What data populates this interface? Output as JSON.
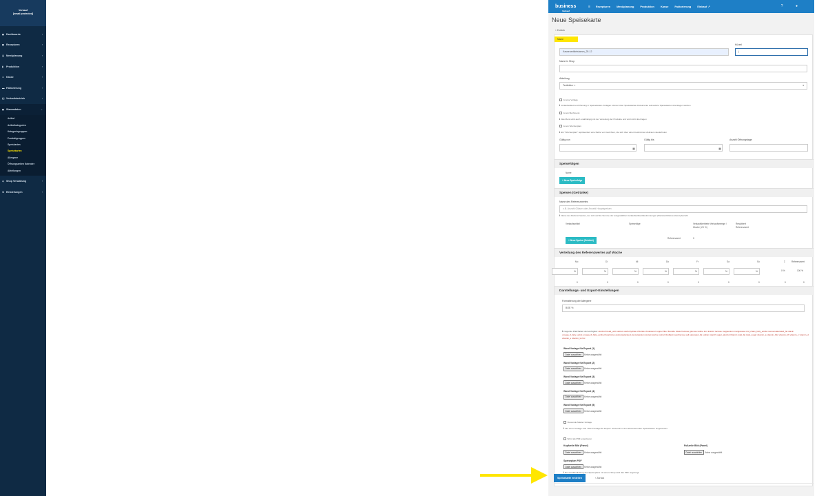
{
  "sidebar": {
    "user": [
      "Verkauf",
      "[email protected]"
    ],
    "items": [
      {
        "label": "Dashboards",
        "icon": "dashboard-icon",
        "glyph": "◼"
      },
      {
        "label": "Rezepturen",
        "icon": "recipe-icon",
        "glyph": "◼"
      },
      {
        "label": "Menüplanung",
        "icon": "menu-planning-icon",
        "glyph": "▤"
      },
      {
        "label": "Produktion",
        "icon": "production-icon",
        "glyph": "▮"
      },
      {
        "label": "Kasse",
        "icon": "cashbox-icon",
        "glyph": "▭"
      },
      {
        "label": "Fakturierung",
        "icon": "invoice-icon",
        "glyph": "▬"
      },
      {
        "label": "Verkaufsbetrieb",
        "icon": "shop-icon",
        "glyph": "◧"
      },
      {
        "label": "Stammdaten",
        "icon": "master-data-icon",
        "glyph": "◼"
      }
    ],
    "subitems": [
      "Artikel",
      "Artikelkategorien",
      "Kategoriegruppen",
      "Produktgruppen",
      "Speiskarten",
      "Speisekarten",
      "Allergene",
      "Öffnungszeiten Kalender",
      "Abteilungen"
    ],
    "active_sub": 5,
    "bottom_items": [
      {
        "label": "Shop Verwaltung",
        "icon": "shop-admin-icon",
        "glyph": "◈"
      },
      {
        "label": "Einstellungen",
        "icon": "settings-icon",
        "glyph": "✿"
      }
    ]
  },
  "topbar": {
    "logo": "business",
    "logo_sub": "Verkauf",
    "menu": [
      "Rezepturen",
      "Menüplanung",
      "Produktion",
      "Kasse",
      "Fakturierung",
      "Einkauf"
    ],
    "hamburger": "≡"
  },
  "page": {
    "title": "Neue Speisekarte",
    "back": "‹ Zurück"
  },
  "form": {
    "name_label": "Name",
    "name_value": "Kassenartikelstamm_25-12",
    "kuerzel_label": "Kürzel",
    "shop_name_label": "Name in Shop",
    "abteilung_label": "Abteilung",
    "abteilung_value": "Testbäder",
    "checkboxes": [
      {
        "label": "Ist eine Vorlage",
        "info": "Vorlaufsetikett und Planung in Speisekarten-Vorlagen können über Speisekarten-Dokumente auf andere Speisekarten übertragen werden"
      },
      {
        "label": "Ist ein Buchmenü",
        "info": "Das Menü wird auch unabhängig mit der Verteilung der Produkte und wird nicht übertragen"
      },
      {
        "label": "Ist ein Wochenplan",
        "info": "Ein \"Wochenplan\" repräsentiert eine Reihe von Gerichten, die sich über einen bestimmten Zeitraum wiederholen"
      }
    ],
    "valid_from": "Gültig von",
    "valid_to": "Gültig bis",
    "opening_days": "Anzahl Öffnungstage"
  },
  "sections": {
    "speisefolgen": "Speisefolgen",
    "speisefolgen_col": "Name",
    "new_speisefolge": "+ Neue Speisefolge",
    "speisen": "Speisen (Getränke)",
    "ref_label": "Name des Referenzwertes",
    "ref_placeholder": "z.B. Anzahl Gläser oder Anzahl Hauptspeisen",
    "ref_info": "Name des Referenzwertes, der sich auf die Summe der ausgewählten Verkaufsartikel-Bestimmungen (Standard Referenzwert) bezieht",
    "cols": [
      "Verkaufsartikel",
      "Speisefolge",
      "Verkaufsbetriebe Verkaufsmenge / Woche (VK %)",
      "Resultierel Referenzwert"
    ],
    "referenzwert_label": "Referenzwert",
    "referenzwert_value": "0",
    "new_speise": "+ Neue Speise (Getränk)",
    "verteilung": "Verteilung des Referenzwertes auf Woche",
    "days": [
      "Mo",
      "Di",
      "Mi",
      "Do",
      "Fr",
      "Sa",
      "So"
    ],
    "sum_col": "Σ",
    "ref_col": "Referenzwert",
    "pct_sign": "%",
    "sum_pct": "0 %",
    "ref_pct": "100 %",
    "zero": "0",
    "darstellung": "Darstellungs- und Export-Einstellungen",
    "formatting_label": "Formatierung der Allergene",
    "formatting_value": "BOE %",
    "placeholder_intro": "Folgende Platzhalter sind verfügbar:",
    "placeholders": "alcohol  bread_unit  calcium  carbohydrate  chloride  cholesterol  copper  fiber  fluoride  folate  fructose  glucose  iodine  iron  kcal  kJ  lactose  magnesium  manganese  mid_chain_fatty_acids  monounsaturated_fat  niacin  omega_3_fatty_acids  omega_6_fatty_acids  phosphorus  polyunsaturated_fat  potassium  protein  purine  retinol  riboflavin  saccharose  salt  saturated_fat  sodium  starch  sugar_alcohol  thiamin  total_fat  total_sugar  vitamin_a  vitamin_b12  vitamin_b6  vitamin_c  vitamin_d  vitamin_e  vitamin_k  zinc",
    "word_templates": [
      "Word Vorlage für Export (1)",
      "Word Vorlage für Export (2)",
      "Word Vorlage für Export (3)",
      "Word Vorlage für Export (4)",
      "Word Vorlage für Export (5)"
    ],
    "file_btn": "Datei auswählen",
    "no_file": "Keine ausgewählt",
    "master_cb": "Verwende Master-Vorlage",
    "master_info": "Nur wenn Vorlage: Die \"Word Vorlage für Export\" wird auch in den abonnierenden Speisekarten eingesendet",
    "pdf_cb": "Word als PDF exportieren",
    "header_img": "Kopfzeile Bild (Panel)",
    "footer_img": "Fußzeile Bild (Panel)",
    "menu_pdf": "Speiseplan PDF",
    "pdf_info": "Bei Veröffentlichung des Speiseplans mit einem Shop wird das PDF angezeigt"
  },
  "buttons": {
    "submit": "Speisekarte erstellen",
    "back": "‹ Zurück"
  }
}
